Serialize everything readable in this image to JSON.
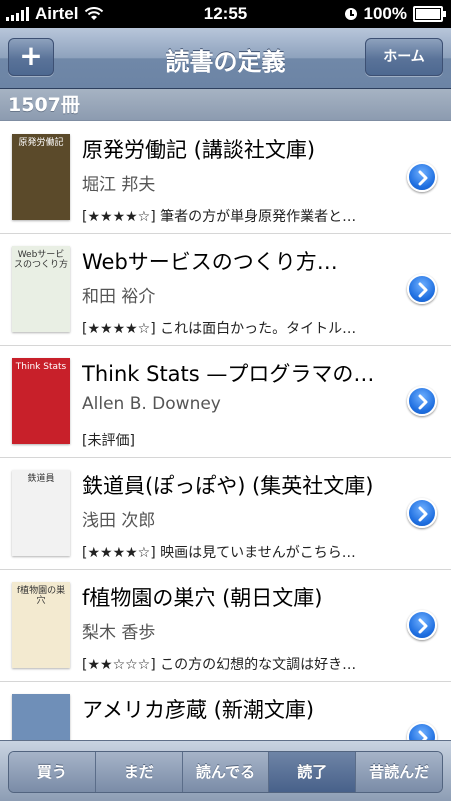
{
  "status_bar": {
    "carrier": "Airtel",
    "time": "12:55",
    "battery": "100%"
  },
  "nav": {
    "add_label": "+",
    "title": "読書の定義",
    "home_label": "ホーム"
  },
  "section": {
    "count": "1507冊"
  },
  "books": [
    {
      "title": "原発労働記 (講談社文庫)",
      "author": "堀江 邦夫",
      "review": "[★★★★☆] 筆者の方が単身原発作業者と…",
      "cover_text": "原発労働記",
      "cover_color": "#5b4a2a"
    },
    {
      "title": "Webサービスのつくり方…",
      "author": "和田 裕介",
      "review": "[★★★★☆] これは面白かった。タイトル…",
      "cover_text": "Webサービスのつくり方",
      "cover_color": "#e9efe4"
    },
    {
      "title": "Think Stats —プログラマの…",
      "author": "Allen B. Downey",
      "review": "[未評価]",
      "cover_text": "Think Stats",
      "cover_color": "#c8202a"
    },
    {
      "title": "鉄道員(ぽっぽや) (集英社文庫)",
      "author": "浅田 次郎",
      "review": "[★★★★☆] 映画は見ていませんがこちら…",
      "cover_text": "鉄道員",
      "cover_color": "#f2f2f2"
    },
    {
      "title": "f植物園の巣穴 (朝日文庫)",
      "author": "梨木 香歩",
      "review": "[★★☆☆☆] この方の幻想的な文調は好き…",
      "cover_text": "f植物園の巣穴",
      "cover_color": "#f3ead0"
    },
    {
      "title": "アメリカ彦蔵 (新潮文庫)",
      "author": "",
      "review": "",
      "cover_text": "",
      "cover_color": "#6f8fb8"
    }
  ],
  "tabs": [
    {
      "label": "買う",
      "active": false
    },
    {
      "label": "まだ",
      "active": false
    },
    {
      "label": "読んでる",
      "active": false
    },
    {
      "label": "読了",
      "active": true
    },
    {
      "label": "昔読んだ",
      "active": false
    }
  ],
  "colors": {
    "accent": "#1f6fe0",
    "nav": "#6c84a5"
  }
}
